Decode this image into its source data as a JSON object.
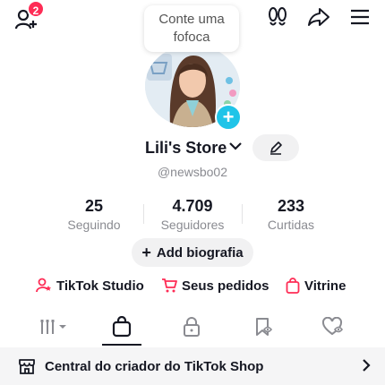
{
  "header": {
    "notification_count": "2",
    "icons": [
      "add-friend-icon",
      "footprints-icon",
      "share-icon",
      "menu-icon"
    ]
  },
  "bubble": {
    "line1": "Conte uma",
    "line2": "fofoca"
  },
  "profile": {
    "name": "Lili's Store",
    "handle": "@newsbo02"
  },
  "stats": [
    {
      "value": "25",
      "label": "Seguindo"
    },
    {
      "value": "4.709",
      "label": "Seguidores"
    },
    {
      "value": "233",
      "label": "Curtidas"
    }
  ],
  "bio_button": "Add biografia",
  "links": [
    {
      "label": "TikTok Studio",
      "icon": "user-star-icon"
    },
    {
      "label": "Seus pedidos",
      "icon": "cart-icon"
    },
    {
      "label": "Vitrine",
      "icon": "bag-icon"
    }
  ],
  "tabs": [
    "grid-icon",
    "shop-bag-icon",
    "lock-icon",
    "bookmark-icon",
    "liked-heart-icon"
  ],
  "shop_row": {
    "label": "Central do criador do TikTok Shop"
  },
  "colors": {
    "accent_pink": "#fe2c55",
    "plus_blue": "#20c4e8",
    "text_primary": "#161823",
    "text_secondary": "#8a8b91"
  }
}
